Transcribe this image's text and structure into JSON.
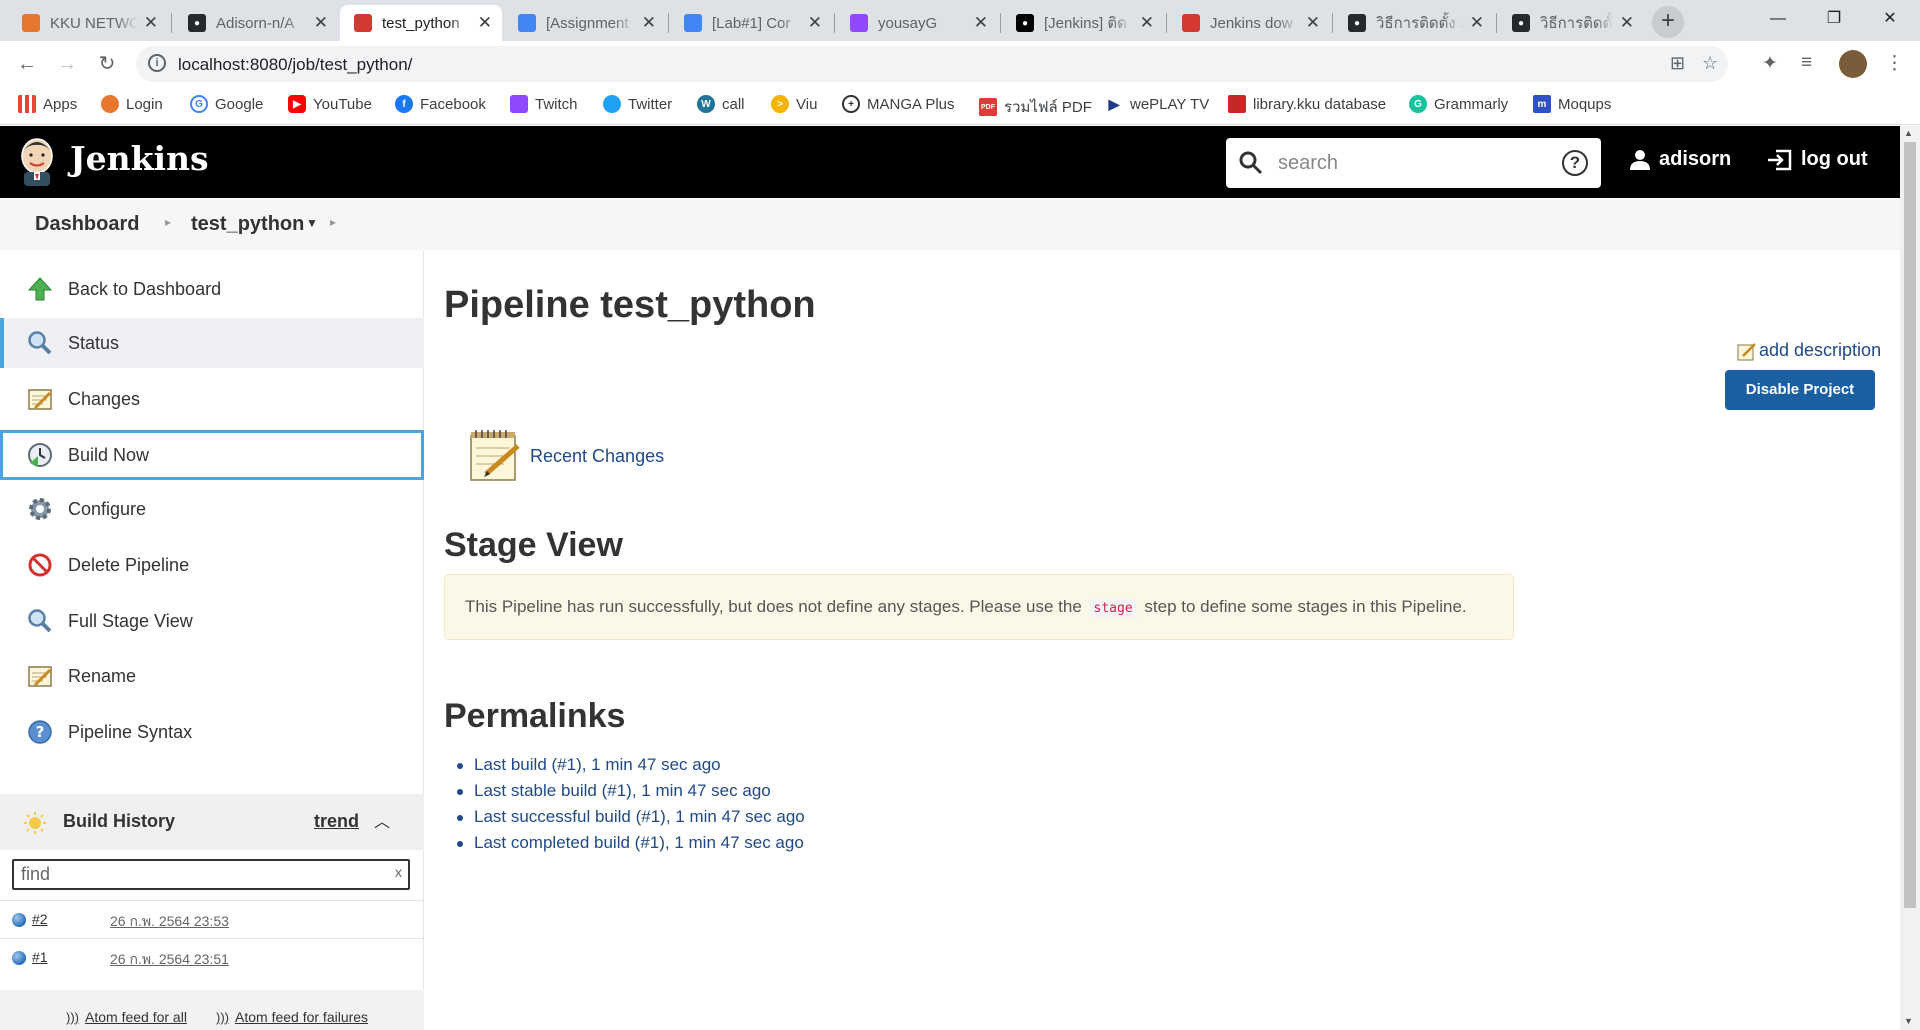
{
  "browser": {
    "tabs": [
      {
        "title": "KKU NETWO",
        "active": false
      },
      {
        "title": "Adisorn-n/A",
        "active": false
      },
      {
        "title": "test_python",
        "active": true
      },
      {
        "title": "[Assignment",
        "active": false
      },
      {
        "title": "[Lab#1] Cor",
        "active": false
      },
      {
        "title": "yousayG",
        "active": false
      },
      {
        "title": "[Jenkins] ติด",
        "active": false
      },
      {
        "title": "Jenkins dow",
        "active": false
      },
      {
        "title": "วิธีการติดตั้ง Je",
        "active": false
      },
      {
        "title": "วิธีการติดตั้ง Je",
        "active": false
      }
    ],
    "url": "localhost:8080/job/test_python/",
    "bookmarks": [
      {
        "label": "Apps",
        "icon": "apps-grid-icon"
      },
      {
        "label": "Login",
        "icon": "flame-icon"
      },
      {
        "label": "Google",
        "icon": "google-icon"
      },
      {
        "label": "YouTube",
        "icon": "youtube-icon"
      },
      {
        "label": "Facebook",
        "icon": "facebook-icon"
      },
      {
        "label": "Twitch",
        "icon": "twitch-icon"
      },
      {
        "label": "Twitter",
        "icon": "twitter-icon"
      },
      {
        "label": "call",
        "icon": "wordpress-icon"
      },
      {
        "label": "Viu",
        "icon": "viu-icon"
      },
      {
        "label": "MANGA Plus",
        "icon": "manga-plus-icon"
      },
      {
        "label": "รวมไฟล์ PDF",
        "icon": "pdf-icon"
      },
      {
        "label": "wePLAY TV",
        "icon": "play-icon"
      },
      {
        "label": "library.kku database",
        "icon": "library-icon"
      },
      {
        "label": "Grammarly",
        "icon": "grammarly-icon"
      },
      {
        "label": "Moqups",
        "icon": "moqups-icon"
      }
    ]
  },
  "jenkins": {
    "brand": "Jenkins",
    "search_placeholder": "search",
    "user": "adisorn",
    "logout": "log out",
    "breadcrumbs": [
      "Dashboard",
      "test_python"
    ],
    "tasks": [
      {
        "label": "Back to Dashboard",
        "icon": "up-arrow-icon"
      },
      {
        "label": "Status",
        "icon": "magnifier-icon"
      },
      {
        "label": "Changes",
        "icon": "notepad-icon"
      },
      {
        "label": "Build Now",
        "icon": "clock-icon"
      },
      {
        "label": "Configure",
        "icon": "gear-icon"
      },
      {
        "label": "Delete Pipeline",
        "icon": "no-entry-icon"
      },
      {
        "label": "Full Stage View",
        "icon": "magnifier-icon"
      },
      {
        "label": "Rename",
        "icon": "notepad-icon"
      },
      {
        "label": "Pipeline Syntax",
        "icon": "help-icon"
      }
    ],
    "build_history": {
      "title": "Build History",
      "trend": "trend",
      "find_placeholder": "find",
      "clear": "x",
      "builds": [
        {
          "number": "#2",
          "date": "26 ก.พ. 2564 23:53"
        },
        {
          "number": "#1",
          "date": "26 ก.พ. 2564 23:51"
        }
      ],
      "feed_all": "Atom feed for all",
      "feed_failures": "Atom feed for failures"
    },
    "page": {
      "title": "Pipeline test_python",
      "add_description": "add description",
      "disable_button": "Disable Project",
      "recent_changes": "Recent Changes",
      "stage_view_title": "Stage View",
      "stage_msg_before": "This Pipeline has run successfully, but does not define any stages. Please use the",
      "stage_msg_code": "stage",
      "stage_msg_after": "step to define some stages in this Pipeline.",
      "permalinks_title": "Permalinks",
      "permalinks": [
        "Last build (#1), 1 min 47 sec ago",
        "Last stable build (#1), 1 min 47 sec ago",
        "Last successful build (#1), 1 min 47 sec ago",
        "Last completed build (#1), 1 min 47 sec ago"
      ]
    }
  },
  "colors": {
    "jenkins_header": "#000000",
    "link": "#204a87",
    "primary_button": "#1b5fa3",
    "selected_border": "#4aa4e1"
  }
}
